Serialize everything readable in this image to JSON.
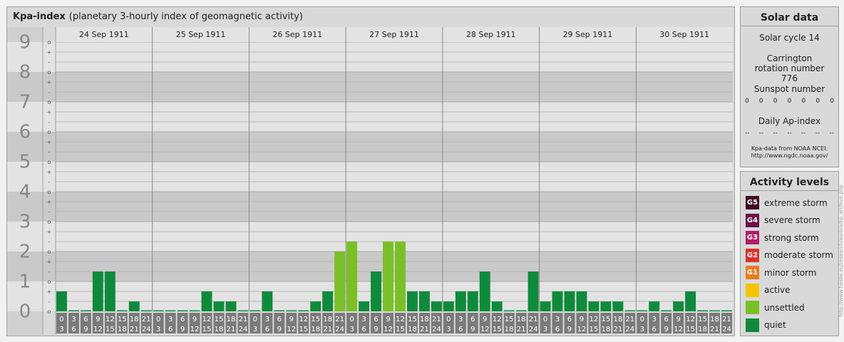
{
  "header": {
    "title": "Kpa-index",
    "subtitle": "(planetary 3-hourly index of geomagnetic activity)"
  },
  "chart_data": {
    "type": "bar",
    "title": "Kpa-index",
    "subtitle": "(planetary 3-hourly index of geomagnetic activity)",
    "ylim": [
      0,
      9
    ],
    "y_major_ticks": [
      "0",
      "1",
      "2",
      "3",
      "4",
      "5",
      "6",
      "7",
      "8",
      "9"
    ],
    "y_minor_ticks": [
      "o",
      "-",
      "+"
    ],
    "days": [
      "24 Sep 1911",
      "25 Sep 1911",
      "26 Sep 1911",
      "27 Sep 1911",
      "28 Sep 1911",
      "29 Sep 1911",
      "30 Sep 1911"
    ],
    "interval_start_labels": [
      "0",
      "3",
      "6",
      "9",
      "12",
      "15",
      "18",
      "21"
    ],
    "interval_end_labels": [
      "3",
      "6",
      "9",
      "12",
      "15",
      "18",
      "21",
      "24"
    ],
    "values": [
      [
        0.67,
        0,
        0,
        1.33,
        1.33,
        0,
        0.33,
        0
      ],
      [
        0,
        0,
        0,
        0,
        0.67,
        0.33,
        0.33,
        0
      ],
      [
        0,
        0.67,
        0,
        0,
        0,
        0.33,
        0.67,
        2
      ],
      [
        2.33,
        0.33,
        1.33,
        2.33,
        2.33,
        0.67,
        0.67,
        0.33
      ],
      [
        0.33,
        0.67,
        0.67,
        1.33,
        0.33,
        0,
        0,
        1.33
      ],
      [
        0.33,
        0.67,
        0.67,
        0.67,
        0.33,
        0.33,
        0.33,
        0
      ],
      [
        0,
        0.33,
        0,
        0.33,
        0.67,
        0,
        0,
        0
      ]
    ],
    "grid": true,
    "colors": {
      "quiet": "#0f8a3c",
      "unsettled": "#7bbf27",
      "active": "#f5c400",
      "minor": "#e87a22",
      "moderate": "#d9322a",
      "strong": "#b01e66",
      "severe": "#6a1146",
      "extreme": "#3c0a22"
    }
  },
  "solar": {
    "title": "Solar data",
    "cycle": "Solar cycle 14",
    "carrington": "Carrington rotation number 776",
    "sunspot_label": "Sunspot number",
    "sunspot_values": [
      "0",
      "0",
      "0",
      "0",
      "0",
      "0",
      "0"
    ],
    "ap_label": "Daily Ap-index",
    "ap_values": [
      "--",
      "--",
      "--",
      "--",
      "--",
      "--",
      "--"
    ],
    "source_line1": "Kpa-data from NOAA NCEI:",
    "source_line2": "http://www.ngdc.noaa.gov/"
  },
  "activity": {
    "title": "Activity levels",
    "levels": [
      {
        "badge": "G5",
        "label": "extreme storm",
        "color": "#3c0a22"
      },
      {
        "badge": "G4",
        "label": "severe storm",
        "color": "#6a1146"
      },
      {
        "badge": "G3",
        "label": "strong storm",
        "color": "#b01e66"
      },
      {
        "badge": "G2",
        "label": "moderate storm",
        "color": "#d9322a"
      },
      {
        "badge": "G1",
        "label": "minor storm",
        "color": "#e87a22"
      },
      {
        "badge": "",
        "label": "active",
        "color": "#f5c400"
      },
      {
        "badge": "",
        "label": "unsettled",
        "color": "#7bbf27"
      },
      {
        "badge": "",
        "label": "quiet",
        "color": "#0f8a3c"
      }
    ]
  },
  "credit": "http://www.tieske.eu/research/aurora/kp_archive.php"
}
